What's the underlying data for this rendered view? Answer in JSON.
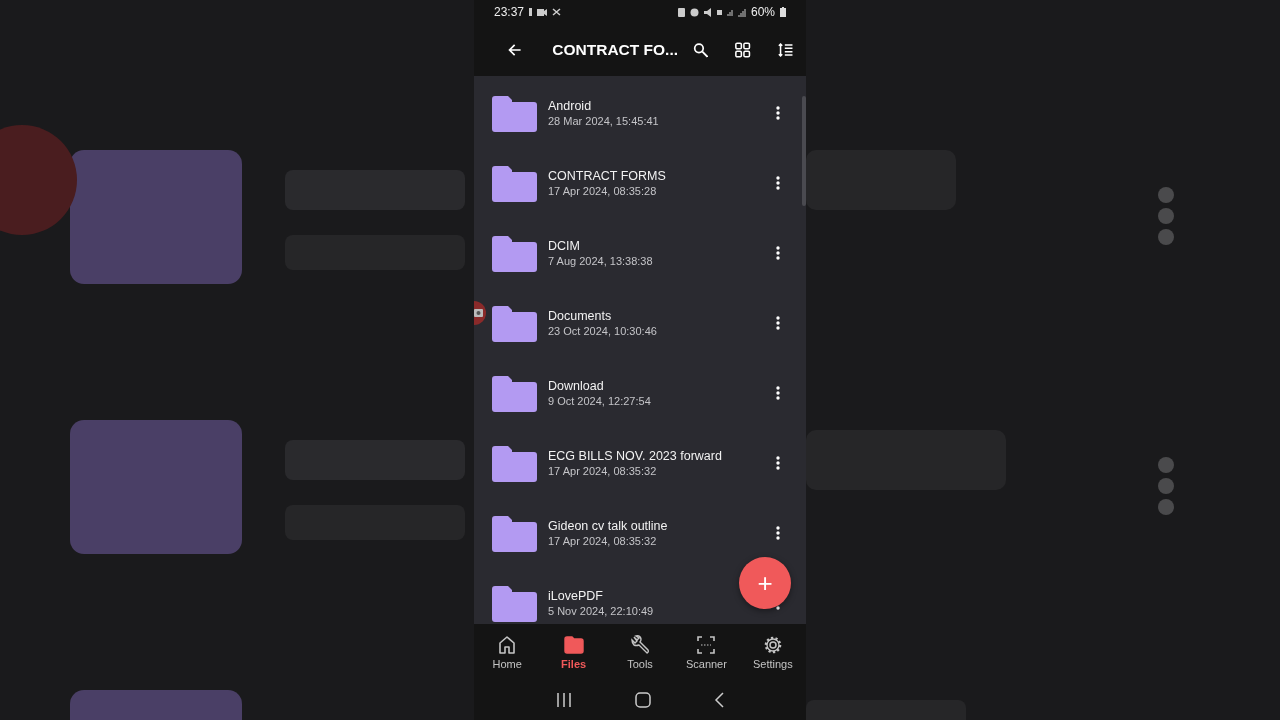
{
  "status_bar": {
    "time": "23:37",
    "battery": "60%"
  },
  "toolbar": {
    "title": "CONTRACT FO..."
  },
  "folders": [
    {
      "name": "Android",
      "date": "28 Mar 2024, 15:45:41"
    },
    {
      "name": "CONTRACT FORMS",
      "date": "17 Apr 2024, 08:35:28"
    },
    {
      "name": "DCIM",
      "date": "7 Aug 2024, 13:38:38"
    },
    {
      "name": "Documents",
      "date": "23 Oct 2024, 10:30:46"
    },
    {
      "name": "Download",
      "date": "9 Oct 2024, 12:27:54"
    },
    {
      "name": "ECG BILLS NOV. 2023 forward",
      "date": "17 Apr 2024, 08:35:32"
    },
    {
      "name": "Gideon cv talk outline",
      "date": "17 Apr 2024, 08:35:32"
    },
    {
      "name": "iLovePDF",
      "date": "5 Nov 2024, 22:10:49"
    }
  ],
  "fab": {
    "label": "+"
  },
  "bottom_nav": [
    {
      "label": "Home",
      "kind": "home",
      "selected": false
    },
    {
      "label": "Files",
      "kind": "files",
      "selected": true
    },
    {
      "label": "Tools",
      "kind": "tools",
      "selected": false
    },
    {
      "label": "Scanner",
      "kind": "scanner",
      "selected": false
    },
    {
      "label": "Settings",
      "kind": "settings",
      "selected": false
    }
  ]
}
